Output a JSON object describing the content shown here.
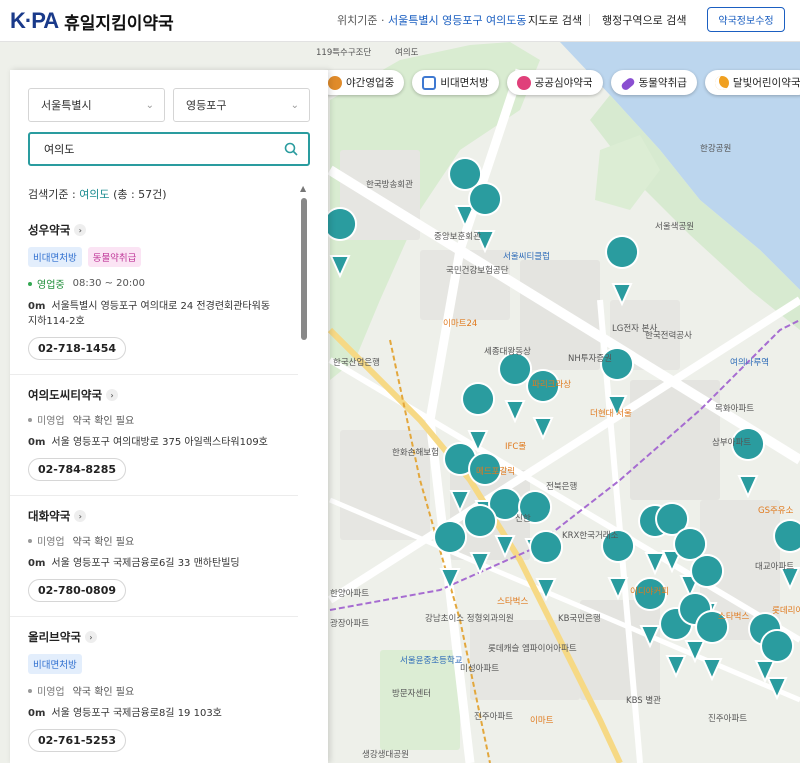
{
  "header": {
    "logo_mark": "K·PA",
    "logo_text": "휴일지킴이약국",
    "location_prefix": "위치기준 · ",
    "location_value": "서울특별시 영등포구 여의도동",
    "nav_map": "지도로 검색",
    "nav_region": "행정구역으로 검색",
    "info_button": "약국정보수정"
  },
  "filters": [
    {
      "label": "야간영업중",
      "icon": "moon-icon",
      "color": "#e08b2a"
    },
    {
      "label": "비대면처방",
      "icon": "monitor-icon",
      "color": "#3f79d1"
    },
    {
      "label": "공공심야약국",
      "icon": "heart-pill-icon",
      "color": "#e0407a"
    },
    {
      "label": "동물약취급",
      "icon": "capsule-icon",
      "color": "#8a4fd1"
    },
    {
      "label": "달빛어린이약국",
      "icon": "crescent-icon",
      "color": "#f0a020"
    }
  ],
  "search": {
    "city": "서울특별시",
    "district": "영등포구",
    "query": "여의도",
    "criteria_prefix": "검색기준 : ",
    "criteria_keyword": "여의도",
    "criteria_total": "(총 : 57건)"
  },
  "results": [
    {
      "name": "성우약국",
      "badges": [
        "비대면처방",
        "동물약취급"
      ],
      "open": true,
      "status": "영업중",
      "hours": "08:30 ~ 20:00",
      "distance": "0m",
      "address": "서울특별시 영등포구 여의대로 24 전경련회관타워동 지하114-2호",
      "phone": "02-718-1454"
    },
    {
      "name": "여의도씨티약국",
      "badges": [],
      "open": false,
      "status": "미영업",
      "hours": "약국 확인 필요",
      "distance": "0m",
      "address": "서울 영등포구 여의대방로 375 아일렉스타워109호",
      "phone": "02-784-8285"
    },
    {
      "name": "대화약국",
      "badges": [],
      "open": false,
      "status": "미영업",
      "hours": "약국 확인 필요",
      "distance": "0m",
      "address": "서울 영등포구 국제금융로6길 33 맨하탄빌딩",
      "phone": "02-780-0809"
    },
    {
      "name": "올리브약국",
      "badges": [
        "비대면처방"
      ],
      "open": false,
      "status": "미영업",
      "hours": "약국 확인 필요",
      "distance": "0m",
      "address": "서울 영등포구 국제금융로8길 19 103호",
      "phone": "02-761-5253"
    }
  ],
  "map_labels": [
    "119특수구조단",
    "여의도",
    "한국방송회관",
    "중앙보훈회관",
    "서울씨티클럽",
    "국민건강보험공단",
    "이마트24",
    "LG전자 본사",
    "한국전력공사",
    "세종대왕동상",
    "NH투자증권",
    "파리크라상",
    "IFC몰",
    "더현대 서울",
    "한화손해보험",
    "메드포갈릭",
    "전북은행",
    "신한",
    "KRX한국거래소",
    "스타벅스",
    "KB국민은행",
    "강남초이스 정형외과의원",
    "롯데캐슬 엠파이어아파트",
    "미성아파트",
    "서울윤중초등학교",
    "방문자센터",
    "KBS 별관",
    "진주아파트",
    "삼부아파트",
    "목화아파트",
    "GS주유소",
    "롯데리아",
    "이디야커피",
    "스타벅스",
    "이마트",
    "진주아파트",
    "생강생대공원",
    "한국산업은행",
    "한양아파트",
    "광장아파트",
    "대교아파트",
    "여의나루역",
    "마포",
    "한강공원",
    "서울색공원"
  ]
}
